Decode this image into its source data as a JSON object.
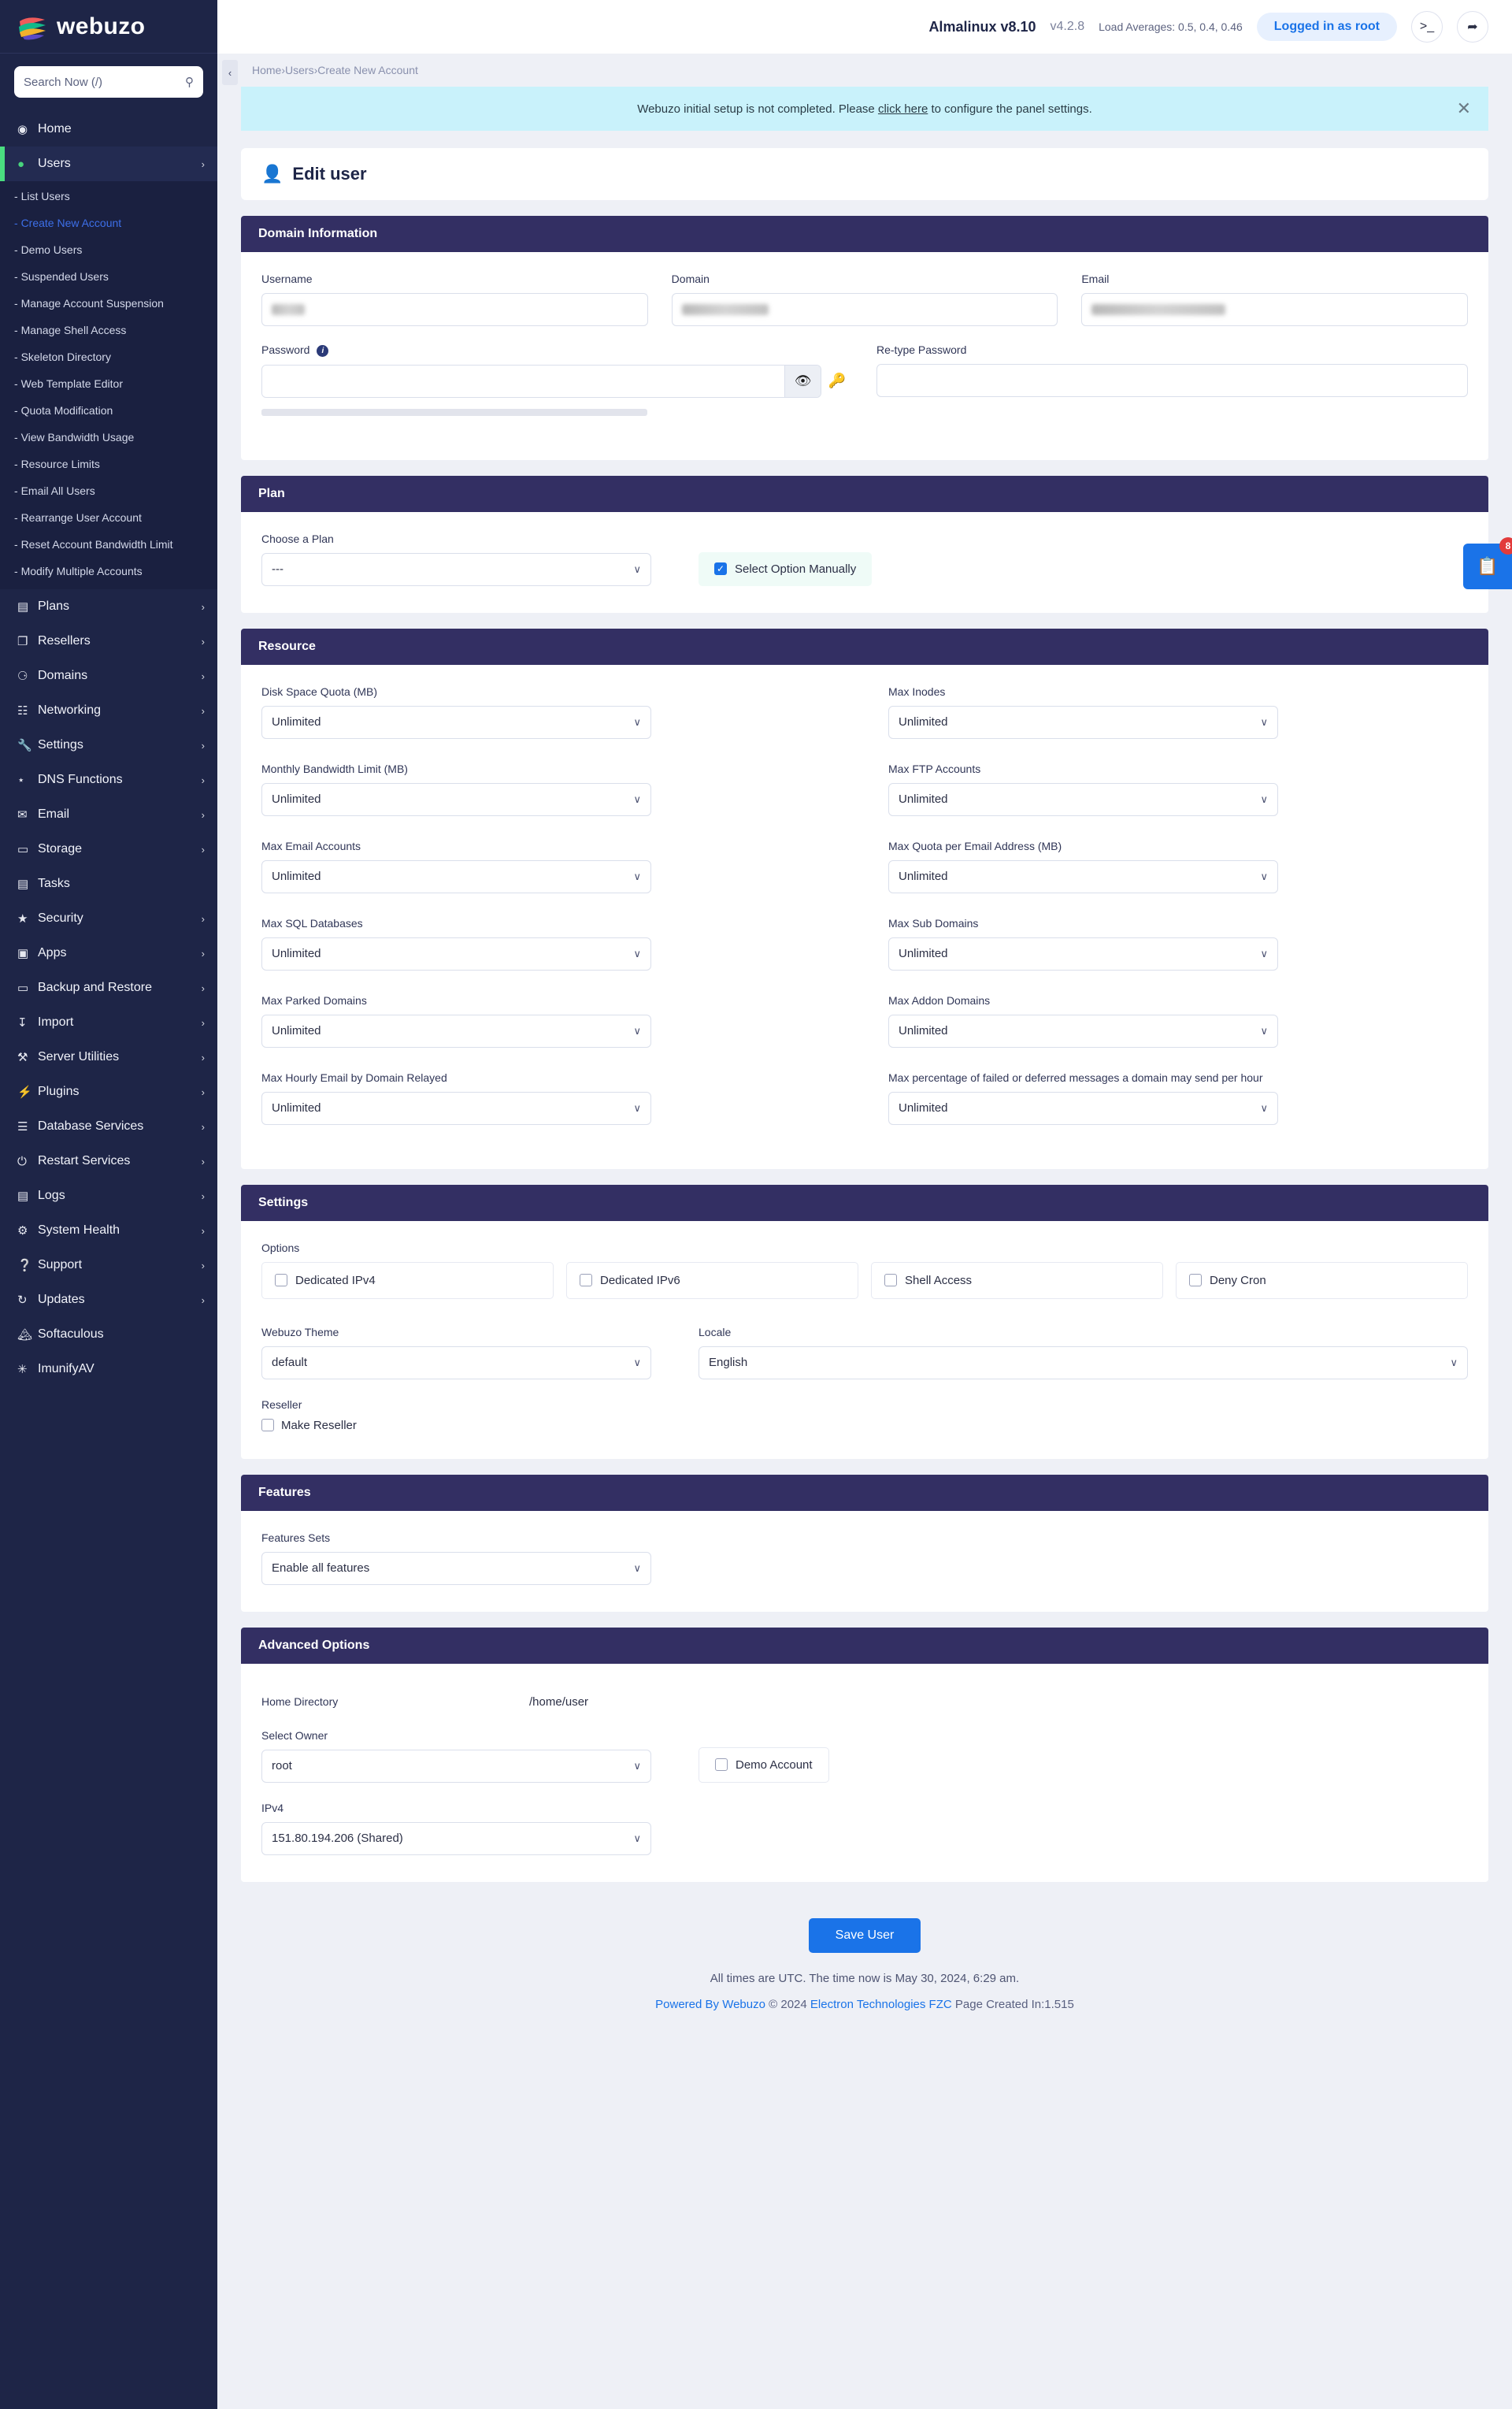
{
  "brand": {
    "name": "webuzo"
  },
  "search": {
    "placeholder": "Search Now (/)",
    "value": ""
  },
  "topbar": {
    "os": "Almalinux v8.10",
    "version": "v4.2.8",
    "load_averages": "Load Averages: 0.5, 0.4, 0.46",
    "logged_in": "Logged in as root",
    "terminal_icon": ">_",
    "logout_icon": "[→"
  },
  "breadcrumb": {
    "items": [
      "Home",
      "Users",
      "Create New Account"
    ],
    "separator": "›"
  },
  "notice": {
    "prefix": "Webuzo initial setup is not completed. Please ",
    "link": "click here",
    "suffix": " to configure the panel settings.",
    "close_icon": "✕"
  },
  "page": {
    "title": "Edit user"
  },
  "floating": {
    "count": "8",
    "icon": "📋"
  },
  "sidebar": {
    "items": [
      {
        "label": "Home",
        "icon": "◔",
        "chevron": ""
      },
      {
        "label": "Users",
        "icon": "👤",
        "chevron": "›",
        "active": true
      },
      {
        "label": "Plans",
        "icon": "▤",
        "chevron": "›"
      },
      {
        "label": "Resellers",
        "icon": "❐",
        "chevron": "›"
      },
      {
        "label": "Domains",
        "icon": "⊕",
        "chevron": "›"
      },
      {
        "label": "Networking",
        "icon": "⛓",
        "chevron": "›"
      },
      {
        "label": "Settings",
        "icon": "🔧",
        "chevron": "›"
      },
      {
        "label": "DNS Functions",
        "icon": "⑂",
        "chevron": "›"
      },
      {
        "label": "Email",
        "icon": "✉",
        "chevron": "›"
      },
      {
        "label": "Storage",
        "icon": "▥",
        "chevron": "›"
      },
      {
        "label": "Tasks",
        "icon": "☰",
        "chevron": ""
      },
      {
        "label": "Security",
        "icon": "⛨",
        "chevron": "›"
      },
      {
        "label": "Apps",
        "icon": "▣",
        "chevron": "›"
      },
      {
        "label": "Backup and Restore",
        "icon": "▥",
        "chevron": "›"
      },
      {
        "label": "Import",
        "icon": "⤓",
        "chevron": "›"
      },
      {
        "label": "Server Utilities",
        "icon": "⚒",
        "chevron": "›"
      },
      {
        "label": "Plugins",
        "icon": "⚡",
        "chevron": "›"
      },
      {
        "label": "Database Services",
        "icon": "⌸",
        "chevron": "›"
      },
      {
        "label": "Restart Services",
        "icon": "⏻",
        "chevron": "›"
      },
      {
        "label": "Logs",
        "icon": "▤",
        "chevron": "›"
      },
      {
        "label": "System Health",
        "icon": "⚙",
        "chevron": "›"
      },
      {
        "label": "Support",
        "icon": "❓",
        "chevron": "›"
      },
      {
        "label": "Updates",
        "icon": "↻",
        "chevron": "›"
      },
      {
        "label": "Softaculous",
        "icon": "🏔",
        "chevron": ""
      },
      {
        "label": "ImunifyAV",
        "icon": "✳",
        "chevron": ""
      }
    ],
    "users_submenu": [
      "List Users",
      "Create New Account",
      "Demo Users",
      "Suspended Users",
      "Manage Account Suspension",
      "Manage Shell Access",
      "Skeleton Directory",
      "Web Template Editor",
      "Quota Modification",
      "View Bandwidth Usage",
      "Resource Limits",
      "Email All Users",
      "Rearrange User Account",
      "Reset Account Bandwidth Limit",
      "Modify Multiple Accounts"
    ],
    "current_submenu": "Create New Account",
    "submenu_prefix": "-"
  },
  "domain_information": {
    "title": "Domain Information",
    "username_label": "Username",
    "username_value": "",
    "domain_label": "Domain",
    "domain_value": "",
    "email_label": "Email",
    "email_value": "",
    "password_label": "Password",
    "password_value": "",
    "retype_label": "Re-type Password",
    "retype_value": "",
    "eye_icon": "👁",
    "key_icon": "🔑"
  },
  "plan": {
    "title": "Plan",
    "choose_label": "Choose a Plan",
    "choose_value": "---",
    "manual_label": "Select Option Manually",
    "manual_checked": true
  },
  "resource": {
    "title": "Resource",
    "fields": [
      {
        "label": "Disk Space Quota (MB)",
        "value": "Unlimited"
      },
      {
        "label": "Max Inodes",
        "value": "Unlimited"
      },
      {
        "label": "Monthly Bandwidth Limit (MB)",
        "value": "Unlimited"
      },
      {
        "label": "Max FTP Accounts",
        "value": "Unlimited"
      },
      {
        "label": "Max Email Accounts",
        "value": "Unlimited"
      },
      {
        "label": "Max Quota per Email Address (MB)",
        "value": "Unlimited"
      },
      {
        "label": "Max SQL Databases",
        "value": "Unlimited"
      },
      {
        "label": "Max Sub Domains",
        "value": "Unlimited"
      },
      {
        "label": "Max Parked Domains",
        "value": "Unlimited"
      },
      {
        "label": "Max Addon Domains",
        "value": "Unlimited"
      },
      {
        "label": "Max Hourly Email by Domain Relayed",
        "value": "Unlimited"
      },
      {
        "label": "Max percentage of failed or deferred messages a domain may send per hour",
        "value": "Unlimited"
      }
    ]
  },
  "settings": {
    "title": "Settings",
    "options_label": "Options",
    "options": [
      {
        "label": "Dedicated IPv4",
        "checked": false
      },
      {
        "label": "Dedicated IPv6",
        "checked": false
      },
      {
        "label": "Shell Access",
        "checked": false
      },
      {
        "label": "Deny Cron",
        "checked": false
      }
    ],
    "theme_label": "Webuzo Theme",
    "theme_value": "default",
    "locale_label": "Locale",
    "locale_value": "English",
    "reseller_label": "Reseller",
    "make_reseller_label": "Make Reseller",
    "make_reseller_checked": false
  },
  "features": {
    "title": "Features",
    "sets_label": "Features Sets",
    "sets_value": "Enable all features"
  },
  "advanced": {
    "title": "Advanced Options",
    "home_dir_label": "Home Directory",
    "home_dir_value": "/home/user",
    "owner_label": "Select Owner",
    "owner_value": "root",
    "demo_label": "Demo Account",
    "demo_checked": false,
    "ipv4_label": "IPv4",
    "ipv4_value": "151.80.194.206 (Shared)"
  },
  "actions": {
    "save_label": "Save User"
  },
  "footer": {
    "time_text": "All times are UTC. The time now is May 30, 2024, 6:29 am.",
    "powered": "Powered By Webuzo",
    "copyright": "© 2024",
    "company": "Electron Technologies FZC",
    "page_created": "Page Created In:1.515"
  },
  "icons": {
    "chevron_down": "∨",
    "check": "✓"
  }
}
